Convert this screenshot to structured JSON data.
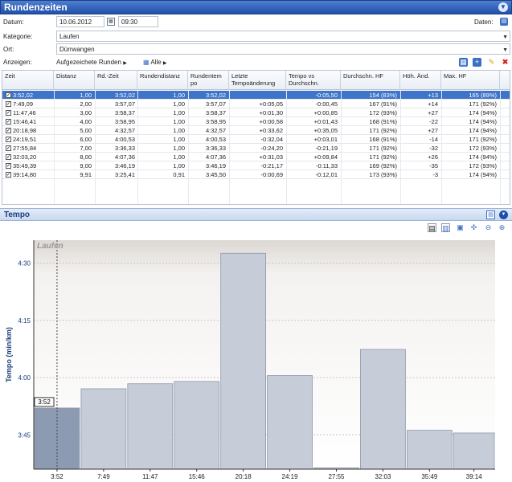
{
  "window": {
    "title": "Rundenzeiten",
    "collapse_icon": "chevron-down-icon"
  },
  "form": {
    "datum_label": "Datum:",
    "datum_value": "10.06.2012",
    "time_value": "09:30",
    "daten_label": "Daten:",
    "kategorie_label": "Kategorie:",
    "kategorie_value": "Laufen",
    "ort_label": "Ort:",
    "ort_value": "Dürrwangen",
    "anzeigen_label": "Anzeigen:",
    "anzeigen_value": "Aufgezeichete Runden",
    "filter_value": "Alle"
  },
  "table": {
    "columns": [
      "Zeit",
      "Distanz",
      "Rd.-Zeit",
      "Rundendistanz",
      "Rundentem po",
      "Letzte Tempoänderung",
      "Tempo vs Durchschn.",
      "Durchschn. HF",
      "Höh. Änd.",
      "Max. HF"
    ],
    "rows": [
      [
        "3:52,02",
        "1,00",
        "3:52,02",
        "1,00",
        "3:52,02",
        "",
        "-0:05,50",
        "154 (83%)",
        "+13",
        "165 (89%)"
      ],
      [
        "7:49,09",
        "2,00",
        "3:57,07",
        "1,00",
        "3:57,07",
        "+0:05,05",
        "-0:00,45",
        "167 (91%)",
        "+14",
        "171 (92%)"
      ],
      [
        "11:47,46",
        "3,00",
        "3:58,37",
        "1,00",
        "3:58,37",
        "+0:01,30",
        "+0:00,85",
        "172 (93%)",
        "+27",
        "174 (94%)"
      ],
      [
        "15:46,41",
        "4,00",
        "3:58,95",
        "1,00",
        "3:58,95",
        "+0:00,58",
        "+0:01,43",
        "168 (91%)",
        "-22",
        "174 (94%)"
      ],
      [
        "20:18,98",
        "5,00",
        "4:32,57",
        "1,00",
        "4:32,57",
        "+0:33,62",
        "+0:35,05",
        "171 (92%)",
        "+27",
        "174 (94%)"
      ],
      [
        "24:19,51",
        "6,00",
        "4:00,53",
        "1,00",
        "4:00,53",
        "-0:32,04",
        "+0:03,01",
        "168 (91%)",
        "-14",
        "171 (92%)"
      ],
      [
        "27:55,84",
        "7,00",
        "3:36,33",
        "1,00",
        "3:36,33",
        "-0:24,20",
        "-0:21,19",
        "171 (92%)",
        "-32",
        "172 (93%)"
      ],
      [
        "32:03,20",
        "8,00",
        "4:07,36",
        "1,00",
        "4:07,36",
        "+0:31,03",
        "+0:09,84",
        "171 (92%)",
        "+26",
        "174 (94%)"
      ],
      [
        "35:49,39",
        "9,00",
        "3:46,19",
        "1,00",
        "3:46,19",
        "-0:21,17",
        "-0:11,33",
        "169 (92%)",
        "-35",
        "172 (93%)"
      ],
      [
        "39:14,80",
        "9,91",
        "3:25,41",
        "0,91",
        "3:45,50",
        "-0:00,69",
        "-0:12,01",
        "173 (93%)",
        "-3",
        "174 (94%)"
      ]
    ]
  },
  "panel": {
    "title": "Tempo"
  },
  "chart_data": {
    "type": "bar",
    "title": "Laufen",
    "ylabel": "Tempo (min/km)",
    "categories": [
      "3:52",
      "7:49",
      "11:47",
      "15:46",
      "20:18",
      "24:19",
      "27:55",
      "32:03",
      "35:49",
      "39:14"
    ],
    "bar_widths_km": [
      1,
      1,
      1,
      1,
      1,
      1,
      1,
      1,
      1,
      0.91
    ],
    "values_min_per_km": [
      3.867,
      3.951,
      3.973,
      3.983,
      4.543,
      4.009,
      3.606,
      4.123,
      3.77,
      3.758
    ],
    "ylim_min": [
      3.6,
      4.6
    ],
    "ytick_labels": [
      "3:45",
      "4:00",
      "4:15",
      "4:30"
    ],
    "ytick_values": [
      3.75,
      4.0,
      4.25,
      4.5
    ],
    "selected_index": 0,
    "selected_label": "3:52",
    "colors": {
      "bar": "#c7cdd8",
      "bar_edge": "#8d97a8",
      "selected": "#8d9bb2",
      "axis": "#1c3e7a",
      "title": "#999999"
    }
  }
}
